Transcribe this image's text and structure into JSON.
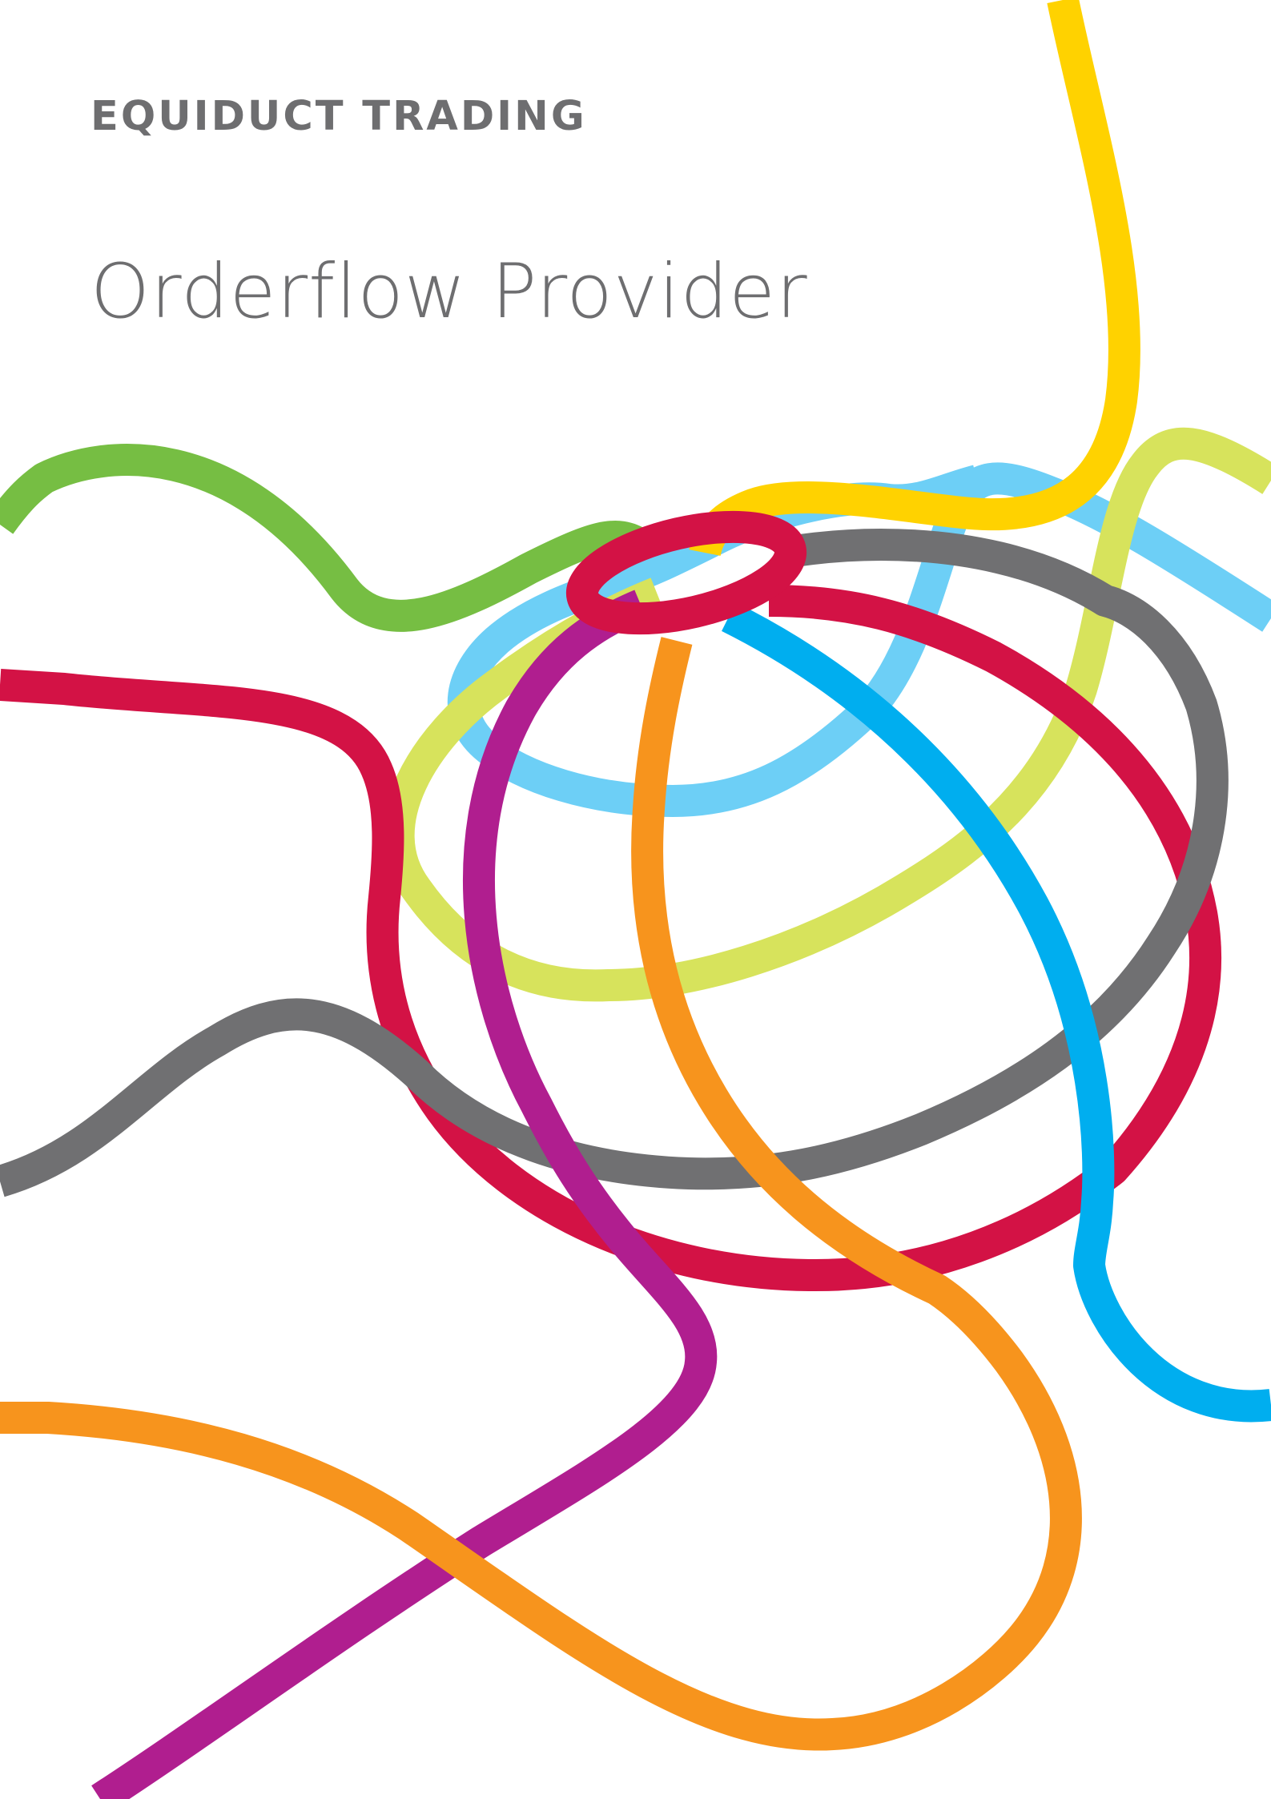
{
  "cover": {
    "brand": "EQUIDUCT TRADING",
    "title": "Orderflow Provider"
  },
  "artwork": {
    "colors": {
      "yellow": "#FFD200",
      "light_blue": "#6DCFF6",
      "lime": "#D7E35C",
      "green": "#76BE43",
      "red": "#D31245",
      "gray": "#707072",
      "blue": "#00AEEF",
      "purple": "#B01E8F",
      "orange": "#F7941D"
    }
  }
}
